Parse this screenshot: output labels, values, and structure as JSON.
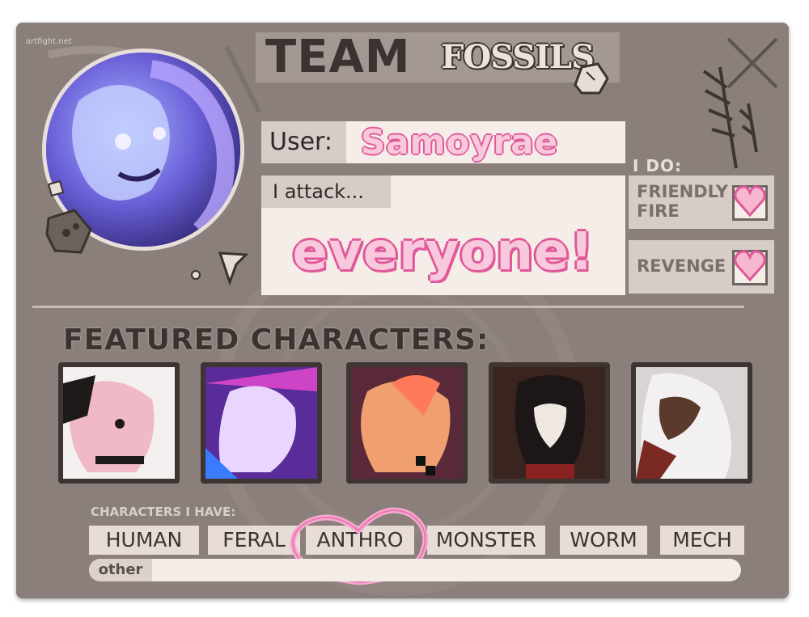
{
  "watermark": "artfight.net",
  "header": {
    "team_label": "TEAM",
    "team_name": "FOSSILS"
  },
  "user": {
    "label": "User:",
    "value": "Samoyrae"
  },
  "attack": {
    "label": "I attack...",
    "value": "everyone!"
  },
  "i_do": {
    "label": "I DO:",
    "options": [
      {
        "line1": "FRIENDLY",
        "line2": "FIRE",
        "checked": true
      },
      {
        "line1": "REVENGE",
        "line2": "",
        "checked": true
      }
    ]
  },
  "featured": {
    "title": "FEATURED CHARACTERS:"
  },
  "characters_i_have": {
    "label": "CHARACTERS I HAVE:",
    "tags": [
      "HUMAN",
      "FERAL",
      "ANTHRO",
      "MONSTER",
      "WORM",
      "MECH"
    ],
    "circled": "ANTHRO"
  },
  "other": {
    "label": "other",
    "value": ""
  },
  "colors": {
    "card_bg": "#8a7f7a",
    "accent_pink": "#e0589a",
    "text_dark": "#3a3330"
  }
}
